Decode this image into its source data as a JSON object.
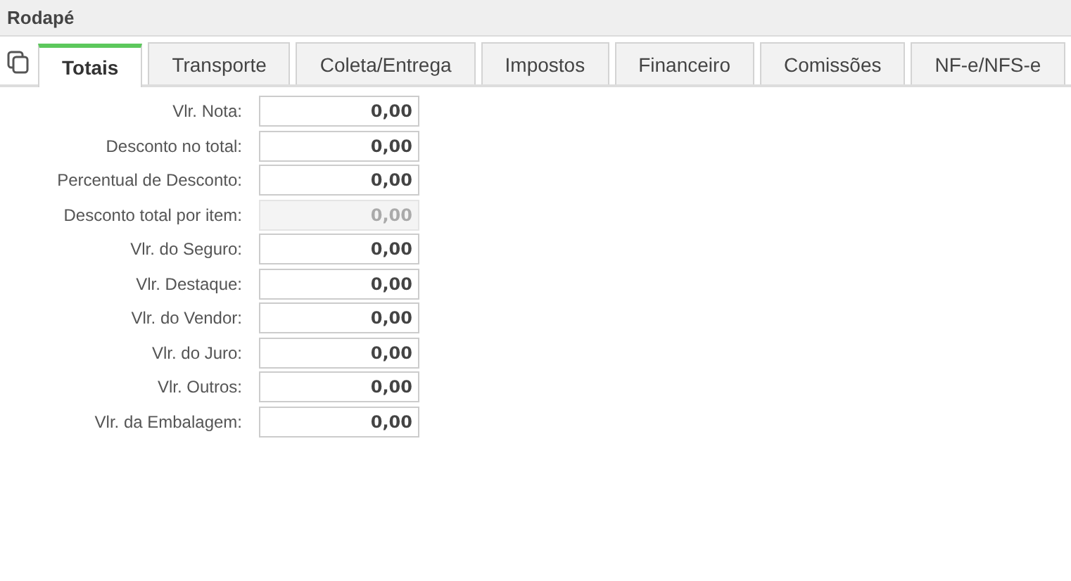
{
  "panel": {
    "title": "Rodapé"
  },
  "tabs": [
    {
      "label": "Totais",
      "selected": true
    },
    {
      "label": "Transporte",
      "selected": false
    },
    {
      "label": "Coleta/Entrega",
      "selected": false
    },
    {
      "label": "Impostos",
      "selected": false
    },
    {
      "label": "Financeiro",
      "selected": false
    },
    {
      "label": "Comissões",
      "selected": false
    },
    {
      "label": "NF-e/NFS-e",
      "selected": false
    }
  ],
  "fields": [
    {
      "label": "Vlr. Nota:",
      "value": "0,00",
      "disabled": false
    },
    {
      "label": "Desconto no total:",
      "value": "0,00",
      "disabled": false
    },
    {
      "label": "Percentual de Desconto:",
      "value": "0,00",
      "disabled": false
    },
    {
      "label": "Desconto total por item:",
      "value": "0,00",
      "disabled": true
    },
    {
      "label": "Vlr. do Seguro:",
      "value": "0,00",
      "disabled": false
    },
    {
      "label": "Vlr. Destaque:",
      "value": "0,00",
      "disabled": false
    },
    {
      "label": "Vlr. do Vendor:",
      "value": "0,00",
      "disabled": false
    },
    {
      "label": "Vlr. do Juro:",
      "value": "0,00",
      "disabled": false
    },
    {
      "label": "Vlr. Outros:",
      "value": "0,00",
      "disabled": false
    },
    {
      "label": "Vlr. da Embalagem:",
      "value": "0,00",
      "disabled": false
    }
  ]
}
